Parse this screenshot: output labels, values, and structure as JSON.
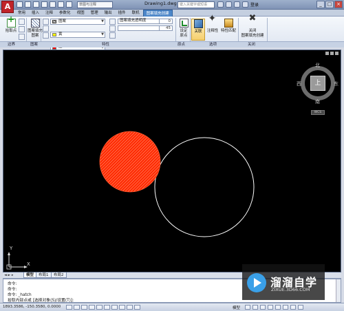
{
  "app": {
    "logo_letter": "A",
    "workspace": "草图与注释",
    "document_title": "Drawing1.dwg",
    "search_placeholder": "键入关键字或短语",
    "login": "登录",
    "window_controls": [
      "_",
      "□",
      "×"
    ]
  },
  "ribbon": {
    "tabs": [
      "常用",
      "插入",
      "注释",
      "参数化",
      "视图",
      "管理",
      "输出",
      "插件",
      "联机",
      "图案填充创建"
    ],
    "active_tab_index": 9,
    "boundary": {
      "pick_points": "拾取点",
      "panel_title": "边界"
    },
    "pattern": {
      "button": "图案填充\n图案",
      "panel_title": "图案"
    },
    "properties": {
      "pattern_type": "图案",
      "pattern_color": "黄",
      "background_color": "红",
      "transparency_label": "图案填充透明度",
      "transparency_value": "0",
      "angle_value": "45",
      "scale_value": "50",
      "panel_title": "特性",
      "colors": {
        "pattern": "#ffff00",
        "background": "#ff0000"
      }
    },
    "origin": {
      "set_origin": "设定\n原点",
      "panel_title": "原点"
    },
    "options": {
      "associative": "关联",
      "annotative": "注释性",
      "match_properties": "特性匹配",
      "panel_title": "选项"
    },
    "close": {
      "button": "关闭\n图案填充创建",
      "panel_title": "关闭"
    }
  },
  "viewcube": {
    "face": "上",
    "north": "北",
    "south": "南",
    "east": "东",
    "west": "西",
    "wcs": "WCS"
  },
  "drawing": {
    "hatched_circle_fill": "#ff2a00",
    "outline_circle_color": "#ffffff",
    "ucs_y": "Y",
    "ucs_x": "X"
  },
  "layout_tabs": {
    "nav": "◄ ► ▸",
    "tabs": [
      "模型",
      "布局1",
      "布局2"
    ],
    "active_index": 0
  },
  "command": {
    "lines": [
      "命令:",
      "命令:",
      "命令: _hatch",
      "拾取内部点或 [选择对象(S)/设置(T)]:"
    ]
  },
  "status": {
    "coords": "1893.3586, -150.3580, 0.0000",
    "model": "模型"
  },
  "watermark": {
    "title": "溜溜自学",
    "url": "ZIXUE.3D66.COM"
  }
}
